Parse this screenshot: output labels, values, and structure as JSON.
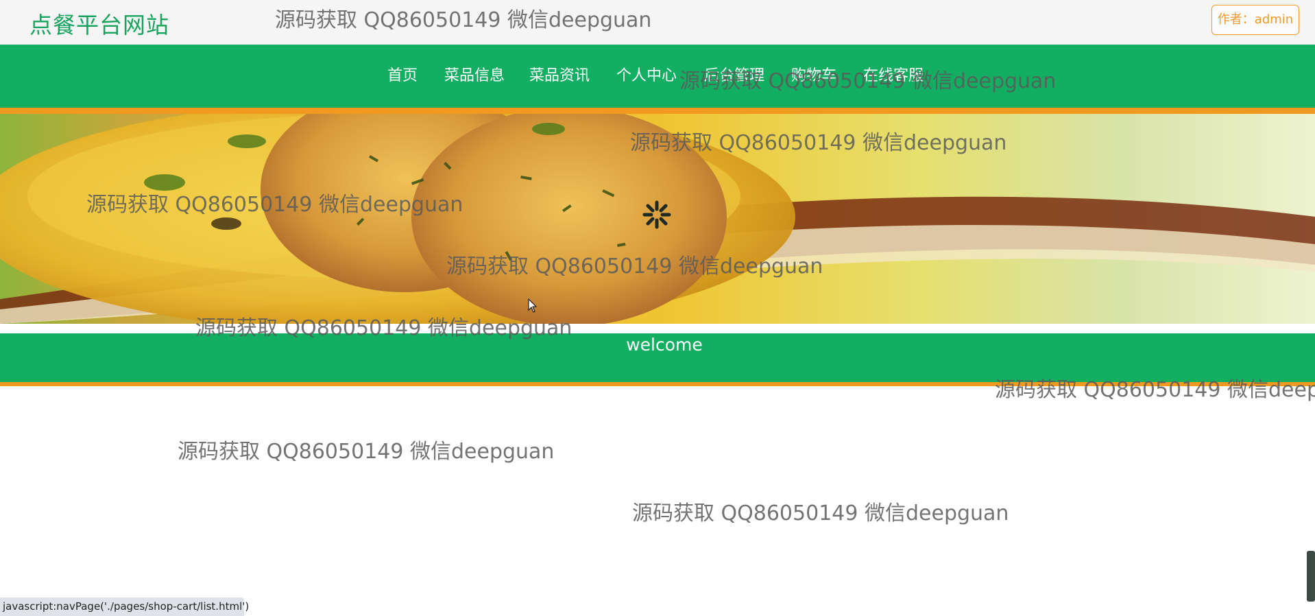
{
  "header": {
    "site_title": "点餐平台网站",
    "author_button": "作者：admin"
  },
  "nav": {
    "items": [
      "首页",
      "菜品信息",
      "菜品资讯",
      "个人中心",
      "后台管理",
      "购物车",
      "在线客服"
    ]
  },
  "banner": {
    "loading_icon": "spinner-icon"
  },
  "welcome": {
    "text": "welcome"
  },
  "watermark": {
    "text": "源码获取 QQ86050149 微信deepguan"
  },
  "status_bar": {
    "text": "javascript:navPage('./pages/shop-cart/list.html')"
  },
  "colors": {
    "brand_green": "#12ae62",
    "accent_orange": "#f29a1f",
    "title_green": "#18a35f"
  }
}
